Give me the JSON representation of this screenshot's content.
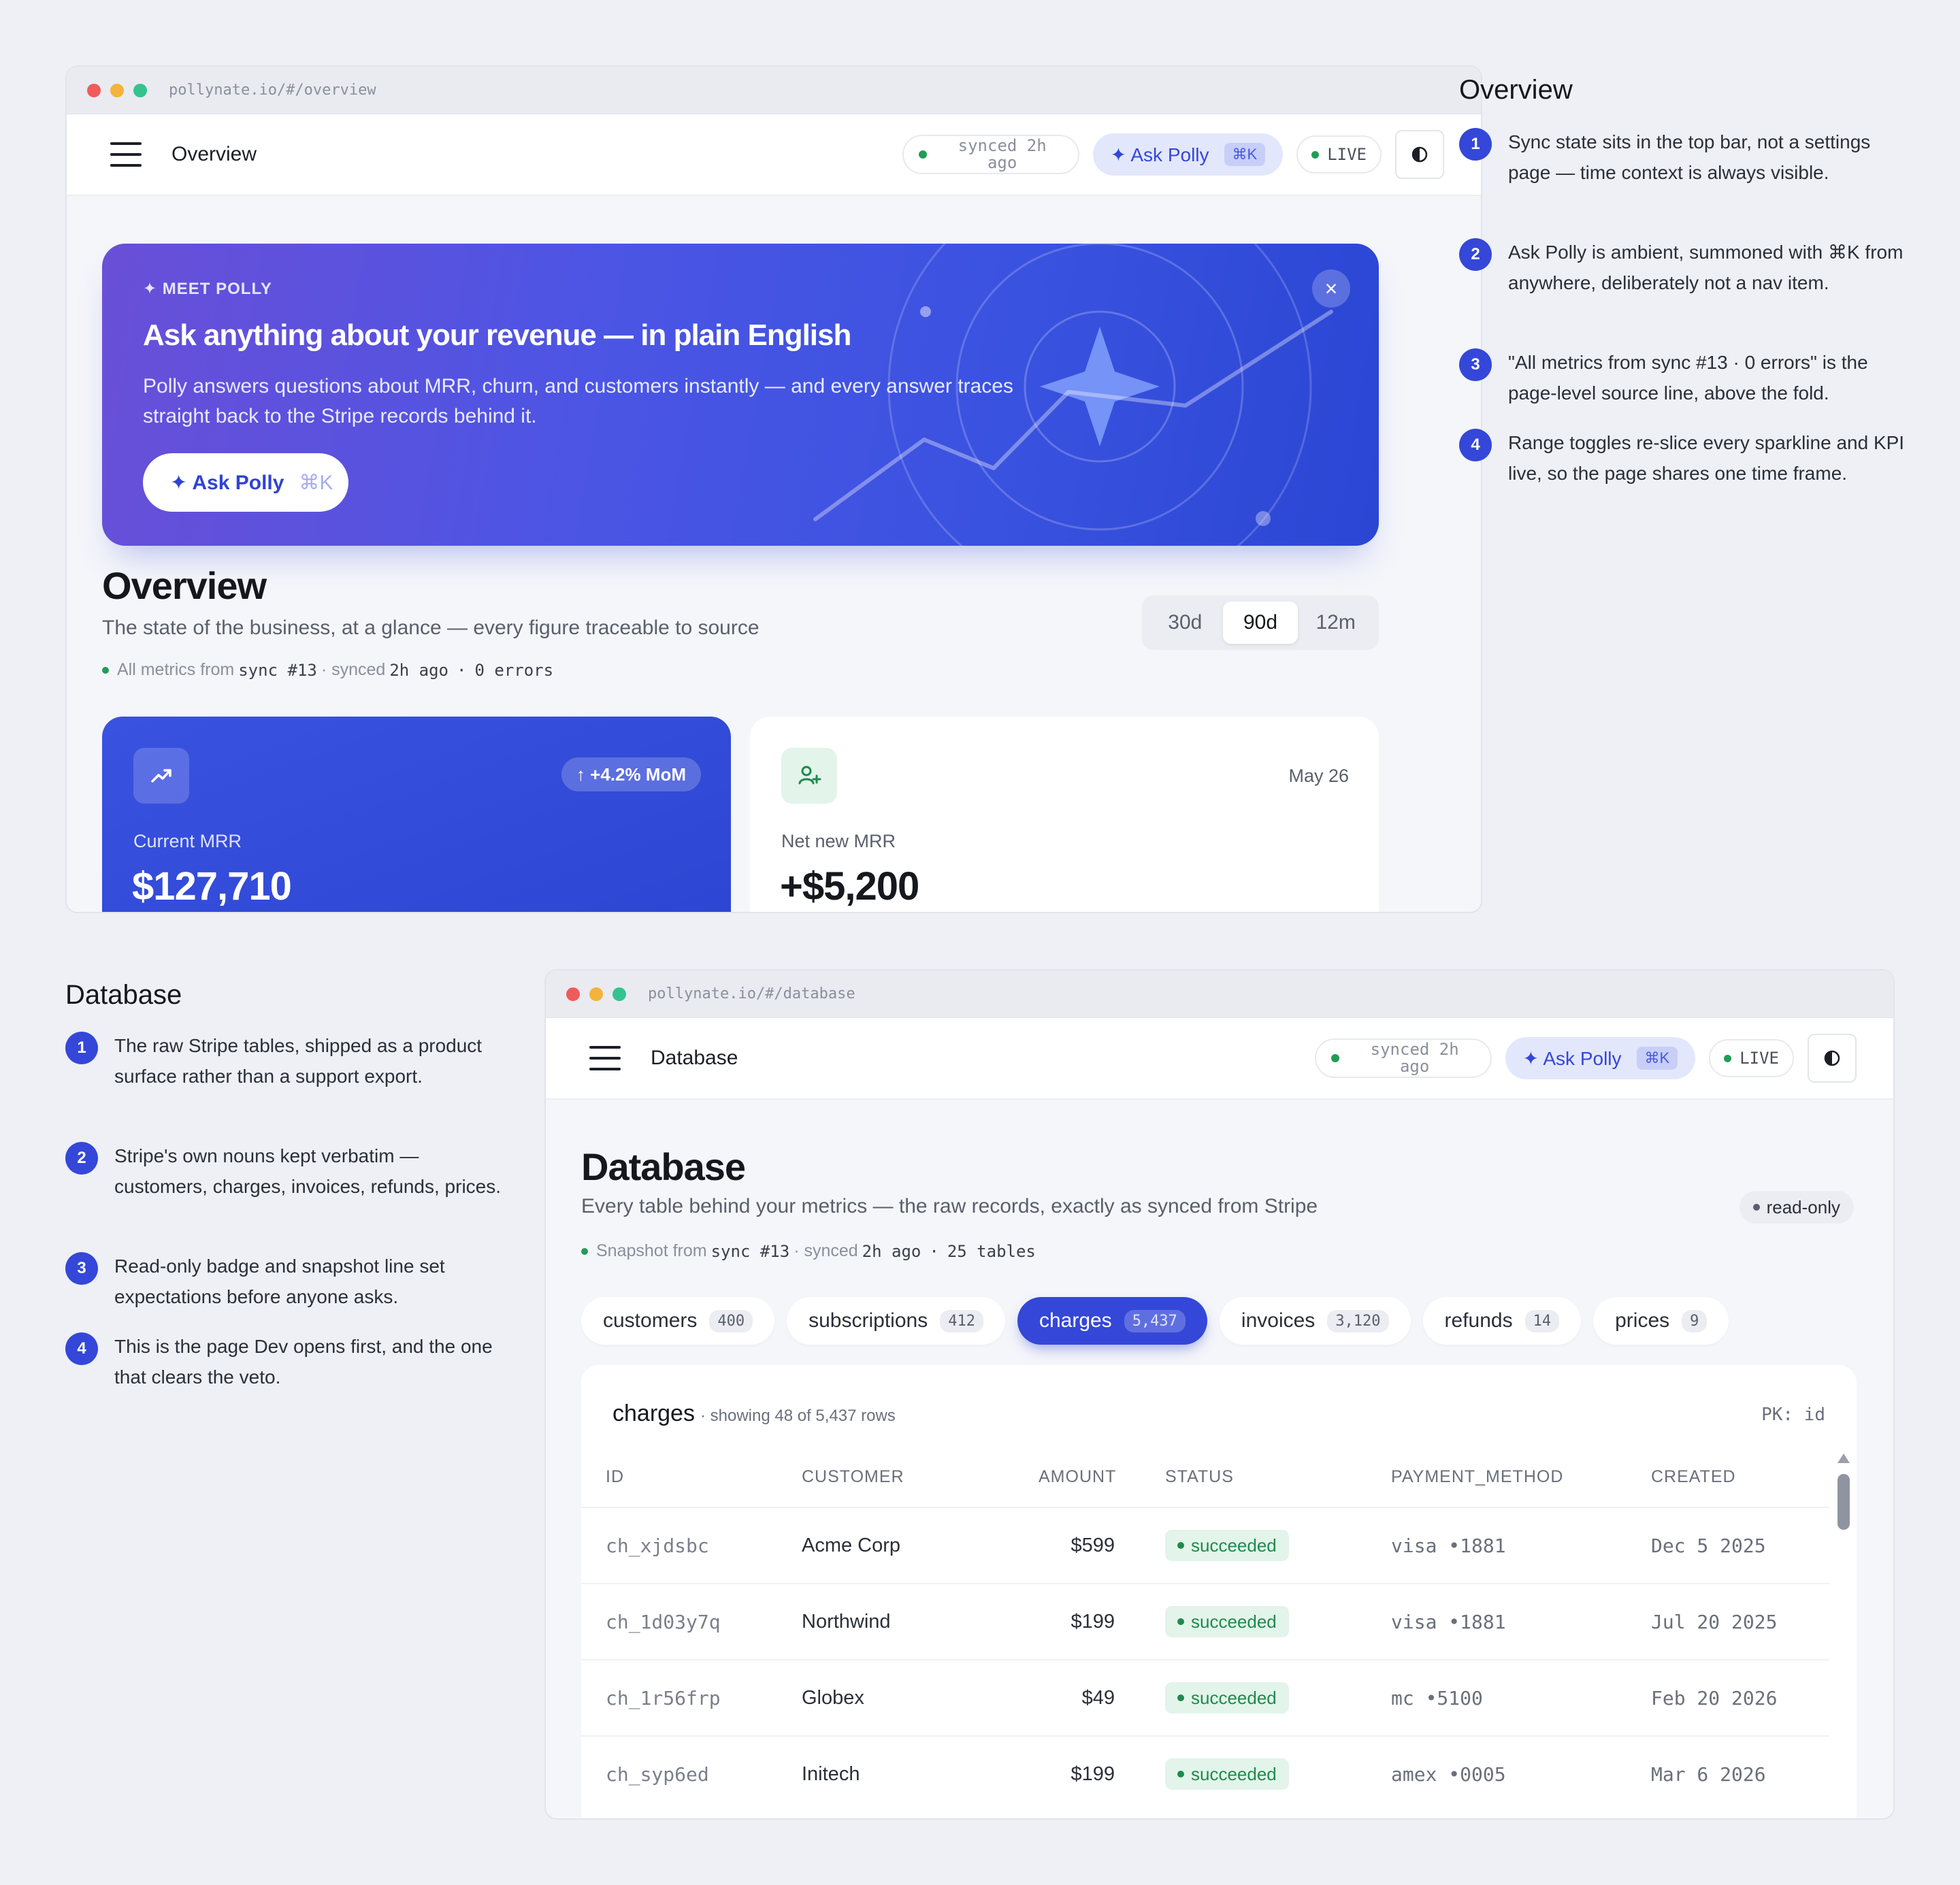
{
  "overview_window": {
    "url": "pollynate.io/#/overview",
    "topbar": {
      "title": "Overview",
      "sync": "synced 2h ago",
      "ask": "✦ Ask Polly",
      "ask_key": "⌘K",
      "live": "LIVE"
    },
    "hero": {
      "kicker": "✦ MEET POLLY",
      "title": "Ask anything about your revenue — in plain English",
      "body": "Polly answers questions about MRR, churn, and customers instantly — and every answer traces straight back to the Stripe records behind it.",
      "button": "✦ Ask Polly",
      "button_key": "⌘K",
      "close": "×"
    },
    "page": {
      "title": "Overview",
      "subtitle": "The state of the business, at a glance — every figure traceable to source",
      "source": {
        "a": "All metrics from",
        "b": "sync #13",
        "c": "· synced",
        "d": "2h ago",
        "e": "·",
        "f": "0 errors"
      }
    },
    "range": {
      "options": [
        "30d",
        "90d",
        "12m"
      ],
      "selected": "90d"
    },
    "kpis": [
      {
        "label": "Current MRR",
        "value": "$127,710",
        "badge": "↑ +4.2% MoM"
      },
      {
        "label": "Net new MRR",
        "value": "+$5,200",
        "date": "May 26"
      }
    ]
  },
  "overview_notes": {
    "title": "Overview",
    "items": [
      {
        "n": "1",
        "text": "Sync state sits in the top bar, not a settings page — time context is always visible."
      },
      {
        "n": "2",
        "text": "Ask Polly is ambient, summoned with ⌘K from anywhere, deliberately not a nav item."
      },
      {
        "n": "3",
        "text": "\"All metrics from sync #13 · 0 errors\" is the page-level source line, above the fold."
      },
      {
        "n": "4",
        "text": "Range toggles re-slice every sparkline and KPI live, so the page shares one time frame."
      }
    ]
  },
  "database_notes": {
    "title": "Database",
    "items": [
      {
        "n": "1",
        "text": "The raw Stripe tables, shipped as a product surface rather than a support export."
      },
      {
        "n": "2",
        "text": "Stripe's own nouns kept verbatim — customers, charges, invoices, refunds, prices."
      },
      {
        "n": "3",
        "text": "Read-only badge and snapshot line set expectations before anyone asks."
      },
      {
        "n": "4",
        "text": "This is the page Dev opens first, and the one that clears the veto."
      }
    ]
  },
  "database_window": {
    "url": "pollynate.io/#/database",
    "topbar": {
      "title": "Database",
      "sync": "synced 2h ago",
      "ask": "✦ Ask Polly",
      "ask_key": "⌘K",
      "live": "LIVE"
    },
    "page": {
      "title": "Database",
      "subtitle": "Every table behind your metrics — the raw records, exactly as synced from Stripe",
      "badge": "read-only",
      "source": {
        "a": "Snapshot from",
        "b": "sync #13",
        "c": "· synced",
        "d": "2h ago",
        "e": "·",
        "f": "25 tables"
      }
    },
    "tabs": [
      {
        "name": "customers",
        "count": "400"
      },
      {
        "name": "subscriptions",
        "count": "412"
      },
      {
        "name": "charges",
        "count": "5,437"
      },
      {
        "name": "invoices",
        "count": "3,120"
      },
      {
        "name": "refunds",
        "count": "14"
      },
      {
        "name": "prices",
        "count": "9"
      }
    ],
    "active_tab": "charges",
    "table": {
      "name": "charges",
      "meta": "· showing 48 of 5,437 rows",
      "pk": "PK: id",
      "columns": [
        "ID",
        "CUSTOMER",
        "AMOUNT",
        "STATUS",
        "PAYMENT_METHOD",
        "CREATED"
      ],
      "rows": [
        [
          "ch_xjdsbc",
          "Acme Corp",
          "$599",
          "succeeded",
          "visa •1881",
          "Dec 5 2025"
        ],
        [
          "ch_1d03y7q",
          "Northwind",
          "$199",
          "succeeded",
          "visa •1881",
          "Jul 20 2025"
        ],
        [
          "ch_1r56frp",
          "Globex",
          "$49",
          "succeeded",
          "mc •5100",
          "Feb 20 2026"
        ],
        [
          "ch_syp6ed",
          "Initech",
          "$199",
          "succeeded",
          "amex •0005",
          "Mar 6 2026"
        ]
      ]
    }
  },
  "colors": {
    "accent": "#3447d8",
    "success": "#1f8a4c",
    "background": "#eef0f5"
  }
}
